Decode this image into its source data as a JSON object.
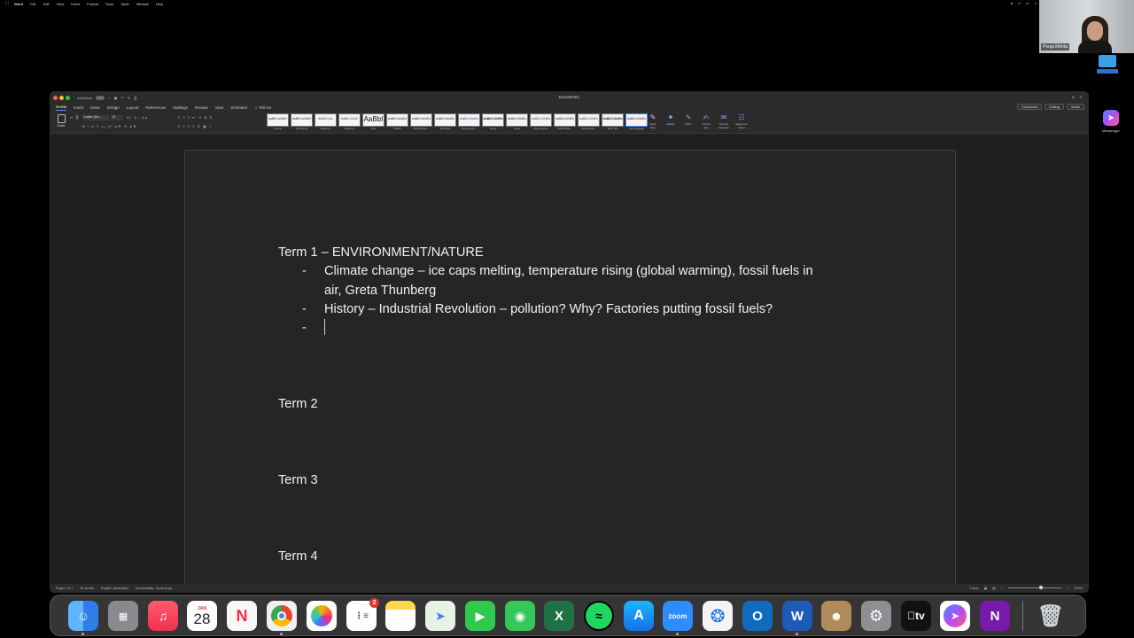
{
  "menubar": {
    "app": "Word",
    "items": [
      "File",
      "Edit",
      "View",
      "Insert",
      "Format",
      "Tools",
      "Table",
      "Window",
      "Help"
    ]
  },
  "video": {
    "participant_name": "Pooja Mehta"
  },
  "desktop": {
    "messenger_label": "Messenger"
  },
  "window": {
    "title": "Document1",
    "autosave_label": "AutoSave",
    "autosave_state": "OFF"
  },
  "ribbon": {
    "tabs": [
      "Home",
      "Insert",
      "Draw",
      "Design",
      "Layout",
      "References",
      "Mailings",
      "Review",
      "View",
      "Scheitest",
      "Tell me"
    ],
    "right_buttons": [
      "Comments",
      "Editing",
      "Share"
    ],
    "paste_label": "Paste",
    "font_name": "Calibri (Bo...",
    "font_size": "12",
    "styles": [
      {
        "preview": "AaBbCcDdEe",
        "name": "Normal"
      },
      {
        "preview": "AaBbCcDdEe",
        "name": "No Spacing"
      },
      {
        "preview": "AaBbCcDc",
        "name": "Heading 1"
      },
      {
        "preview": "AaBbCcDdE",
        "name": "Heading 2"
      },
      {
        "preview": "AaBbI",
        "name": "Title"
      },
      {
        "preview": "AaBbCcDdEe",
        "name": "Subtitle"
      },
      {
        "preview": "AaBbCcDdEe",
        "name": "Subtle Emph..."
      },
      {
        "preview": "AaBbCcDdEe",
        "name": "Emphasis"
      },
      {
        "preview": "AaBbCcDdEe",
        "name": "Intense Emp..."
      },
      {
        "preview": "AaBbCcDdEe",
        "name": "Strong"
      },
      {
        "preview": "AaBbCcDdEe",
        "name": "Quote"
      },
      {
        "preview": "AaBbCcDdEe",
        "name": "Intense Quote"
      },
      {
        "preview": "AaBbCcDdEe",
        "name": "Subtle Refer..."
      },
      {
        "preview": "AaBbCcDdEe",
        "name": "Intense Refe..."
      },
      {
        "preview": "AaBbCcDdEe",
        "name": "Book Title"
      },
      {
        "preview": "AaBbCcDdEe",
        "name": "List Paragraph"
      }
    ],
    "tools": [
      {
        "label": "Styles Pane"
      },
      {
        "label": "Dictate"
      },
      {
        "label": "Editor"
      },
      {
        "label": "Fill and Sign"
      },
      {
        "label": "Send for Signature"
      },
      {
        "label": "Agreement Status"
      }
    ]
  },
  "document": {
    "lines": [
      "Term 1 – ENVIRONMENT/NATURE",
      "Climate change – ice caps melting, temperature rising (global warming), fossil fuels in",
      "air, Greta Thunberg",
      "History – Industrial Revolution – pollution? Why? Factories putting fossil fuels?",
      "Term 2",
      "Term 3",
      "Term 4"
    ],
    "bullet": "-"
  },
  "statusbar": {
    "page": "Page 1 of 1",
    "words": "31 words",
    "language": "English (Australia)",
    "accessibility": "Accessibility: Good to go",
    "focus": "Focus",
    "zoom": "229%"
  },
  "dock": {
    "calendar_month": "JAN",
    "calendar_day": "28",
    "reminders_badge": "2",
    "zoom_label": "zoom",
    "tv_label": "tv"
  },
  "colors": {
    "accent": "#4b8df8",
    "page_bg": "#252525",
    "text": "#f2f2f2"
  }
}
